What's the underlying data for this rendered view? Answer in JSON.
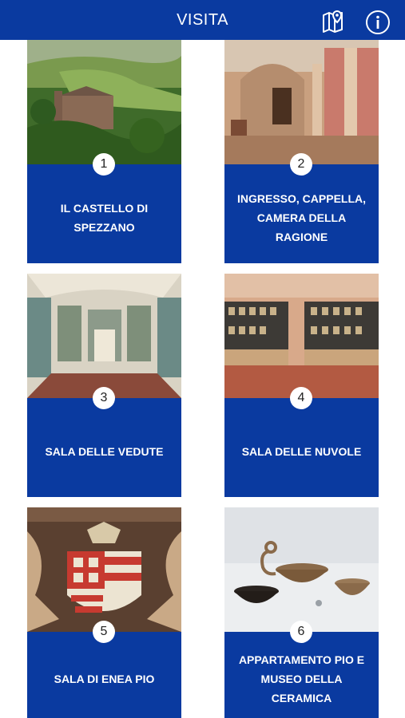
{
  "header": {
    "title": "VISITA"
  },
  "icons": {
    "map": "map-pin-icon",
    "info": "info-icon"
  },
  "colors": {
    "brand_blue": "#0a3aa0",
    "white": "#ffffff"
  },
  "cards": [
    {
      "number": "1",
      "label": "IL CASTELLO DI SPEZZANO"
    },
    {
      "number": "2",
      "label": "INGRESSO, CAPPELLA, CAMERA DELLA RAGIONE"
    },
    {
      "number": "3",
      "label": "SALA DELLE VEDUTE"
    },
    {
      "number": "4",
      "label": "SALA DELLE NUVOLE"
    },
    {
      "number": "5",
      "label": "SALA DI ENEA PIO"
    },
    {
      "number": "6",
      "label": "APPARTAMENTO PIO E MUSEO DELLA CERAMICA"
    }
  ]
}
